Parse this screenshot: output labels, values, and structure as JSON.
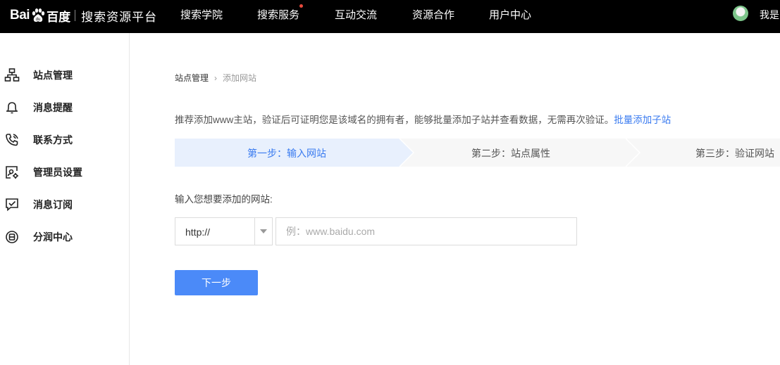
{
  "header": {
    "logo": {
      "bai": "Bai",
      "du": "百度",
      "title": "搜索资源平台"
    },
    "nav": [
      {
        "label": "搜索学院",
        "has_dot": false
      },
      {
        "label": "搜索服务",
        "has_dot": true
      },
      {
        "label": "互动交流",
        "has_dot": false
      },
      {
        "label": "资源合作",
        "has_dot": false
      },
      {
        "label": "用户中心",
        "has_dot": false
      }
    ],
    "user_name": "我是",
    "dot_color": "#e84a3c"
  },
  "sidebar": {
    "items": [
      {
        "label": "站点管理",
        "icon": "sitemap-icon"
      },
      {
        "label": "消息提醒",
        "icon": "bell-icon"
      },
      {
        "label": "联系方式",
        "icon": "phone-icon"
      },
      {
        "label": "管理员设置",
        "icon": "admin-settings-icon"
      },
      {
        "label": "消息订阅",
        "icon": "subscribe-message-icon"
      },
      {
        "label": "分润中心",
        "icon": "revenue-share-icon"
      }
    ]
  },
  "main": {
    "breadcrumb": {
      "parent": "站点管理",
      "separator": "›",
      "current": "添加网站"
    },
    "intro_text": "推荐添加www主站，验证后可证明您是该域名的拥有者，能够批量添加子站并查看数据，无需再次验证。",
    "intro_link": "批量添加子站",
    "steps": [
      {
        "label": "第一步：输入网站",
        "active": true
      },
      {
        "label": "第二步：站点属性",
        "active": false
      },
      {
        "label": "第三步：验证网站",
        "active": false
      }
    ],
    "field_label": "输入您想要添加的网站:",
    "protocol": {
      "value": "http://"
    },
    "url_input": {
      "value": "",
      "placeholder": "例：www.baidu.com"
    },
    "next_button": "下一步"
  },
  "colors": {
    "accent": "#3a7bf0",
    "button": "#4b8af8",
    "step_active_bg": "#e8f0fd",
    "step_idle_bg": "#f7f7f7",
    "topbar": "#000000"
  }
}
